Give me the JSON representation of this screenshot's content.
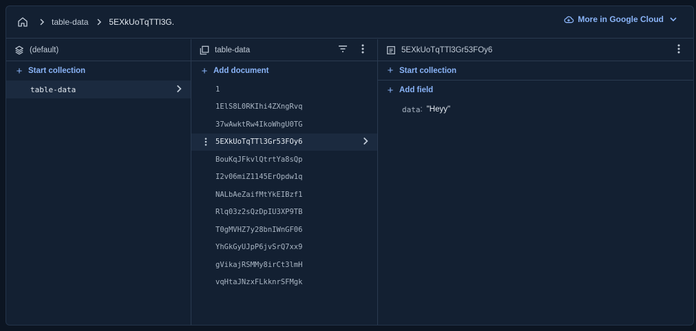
{
  "breadcrumb": {
    "items": [
      "table-data",
      "5EXkUoTqTTl3G."
    ]
  },
  "cloud": {
    "label": "More in Google Cloud"
  },
  "column1": {
    "title": "(default)",
    "action": "Start collection",
    "items": [
      "table-data"
    ]
  },
  "column2": {
    "title": "table-data",
    "action": "Add document",
    "items": [
      "1",
      "1ElS8L0RKIhi4ZXngRvq",
      "37wAwktRw4IkoWhgU0TG",
      "5EXkUoTqTTl3Gr53FOy6",
      "BouKqJFkvlQtrtYa8sQp",
      "I2v06miZ1145ErOpdw1q",
      "NALbAeZaifMtYkEIBzf1",
      "Rlq03z2sQzDpIU3XP9TB",
      "T0gMVHZ7y28bnIWnGF06",
      "YhGkGyUJpP6jvSrQ7xx9",
      "gVikajRSMMy8irCt3lmH",
      "vqHtaJNzxFLkknrSFMgk"
    ],
    "selected_index": 3
  },
  "column3": {
    "title": "5EXkUoTqTTl3Gr53FOy6",
    "start_collection": "Start collection",
    "add_field": "Add field",
    "fields": [
      {
        "key": "data",
        "value": "\"Heyy\""
      }
    ]
  },
  "colors": {
    "background": "#0c1522",
    "panel": "#132032",
    "accent": "#8ab4f8",
    "selected_row": "#1b2a3f"
  }
}
